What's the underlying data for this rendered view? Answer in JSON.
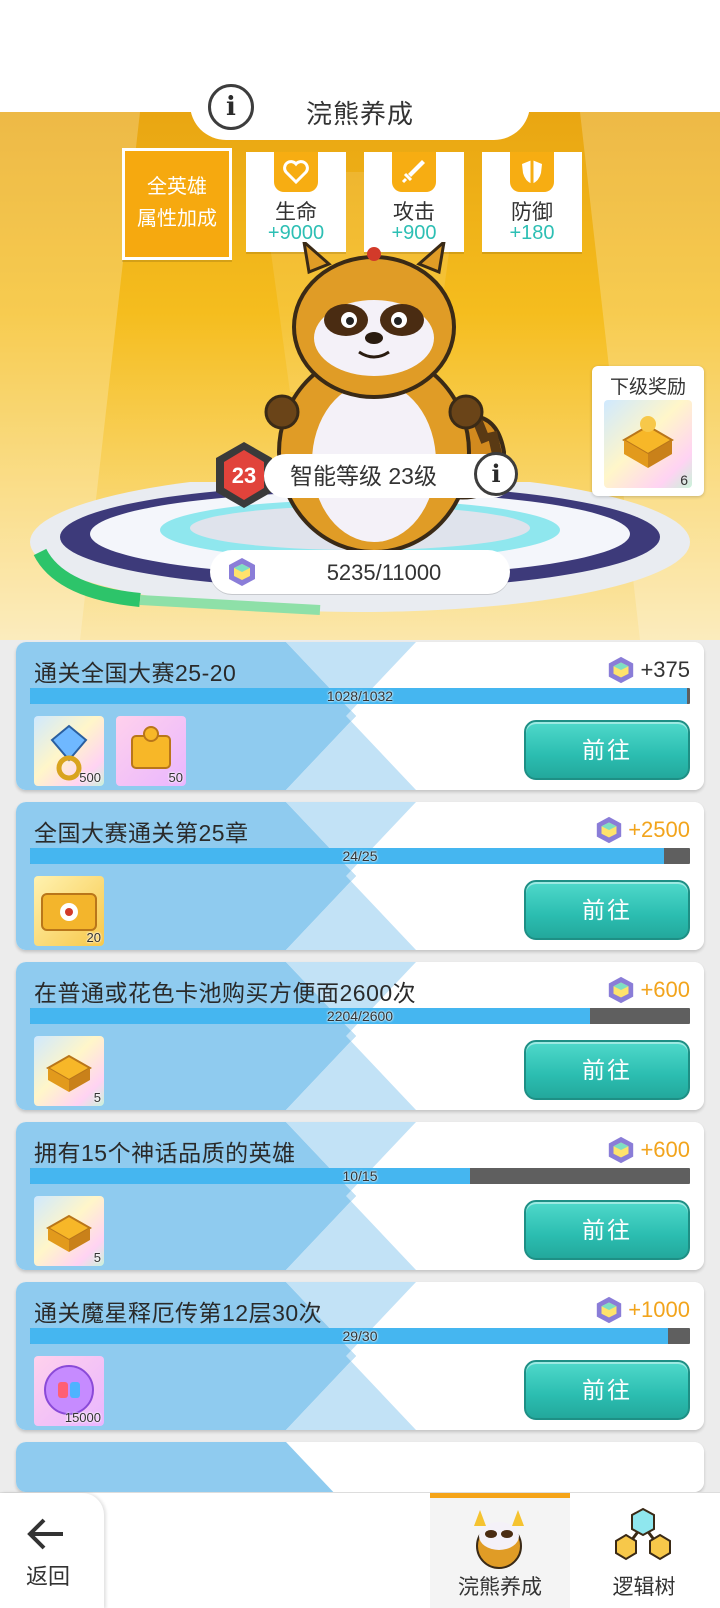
{
  "header": {
    "title": "浣熊养成"
  },
  "attributes": {
    "all_label_1": "全英雄",
    "all_label_2": "属性加成",
    "items": [
      {
        "name": "生命",
        "value": "+9000",
        "icon": "heart-icon"
      },
      {
        "name": "攻击",
        "value": "+900",
        "icon": "sword-icon"
      },
      {
        "name": "防御",
        "value": "+180",
        "icon": "shield-icon"
      }
    ]
  },
  "level": {
    "badge": "23",
    "label": "智能等级 23级"
  },
  "xp": {
    "text": "5235/11000",
    "current": 5235,
    "max": 11000
  },
  "next_reward": {
    "title": "下级奖励",
    "count": "6",
    "icon": "gold-puzzle-icon"
  },
  "tasks": [
    {
      "title": "通关全国大赛25-20",
      "reward": "+375",
      "reward_color": "#333333",
      "progress": "1028/1032",
      "fraction": 0.996,
      "items": [
        {
          "icon": "diamond-ring-icon",
          "count": "500",
          "bg": "rainbow"
        },
        {
          "icon": "puzzle-piece-icon",
          "count": "50",
          "bg": "pink"
        }
      ],
      "button": "前往"
    },
    {
      "title": "全国大赛通关第25章",
      "reward": "+2500",
      "reward_color": "#f2a41c",
      "progress": "24/25",
      "fraction": 0.96,
      "items": [
        {
          "icon": "ticket-icon",
          "count": "20",
          "bg": "gold"
        }
      ],
      "button": "前往"
    },
    {
      "title": "在普通或花色卡池购买方便面2600次",
      "reward": "+600",
      "reward_color": "#f2a41c",
      "progress": "2204/2600",
      "fraction": 0.848,
      "items": [
        {
          "icon": "gold-puzzle-icon",
          "count": "5",
          "bg": "rainbow"
        }
      ],
      "button": "前往"
    },
    {
      "title": "拥有15个神话品质的英雄",
      "reward": "+600",
      "reward_color": "#f2a41c",
      "progress": "10/15",
      "fraction": 0.667,
      "items": [
        {
          "icon": "gold-puzzle-icon",
          "count": "5",
          "bg": "rainbow"
        }
      ],
      "button": "前往"
    },
    {
      "title": "通关魔星释厄传第12层30次",
      "reward": "+1000",
      "reward_color": "#f2a41c",
      "progress": "29/30",
      "fraction": 0.967,
      "items": [
        {
          "icon": "orb-icon",
          "count": "15000",
          "bg": "pink"
        }
      ],
      "button": "前往"
    }
  ],
  "nav": {
    "back": "返回",
    "tabs": [
      {
        "label": "浣熊养成",
        "active": true,
        "icon": "raccoon-icon"
      },
      {
        "label": "逻辑树",
        "active": false,
        "icon": "logic-tree-icon"
      }
    ]
  }
}
